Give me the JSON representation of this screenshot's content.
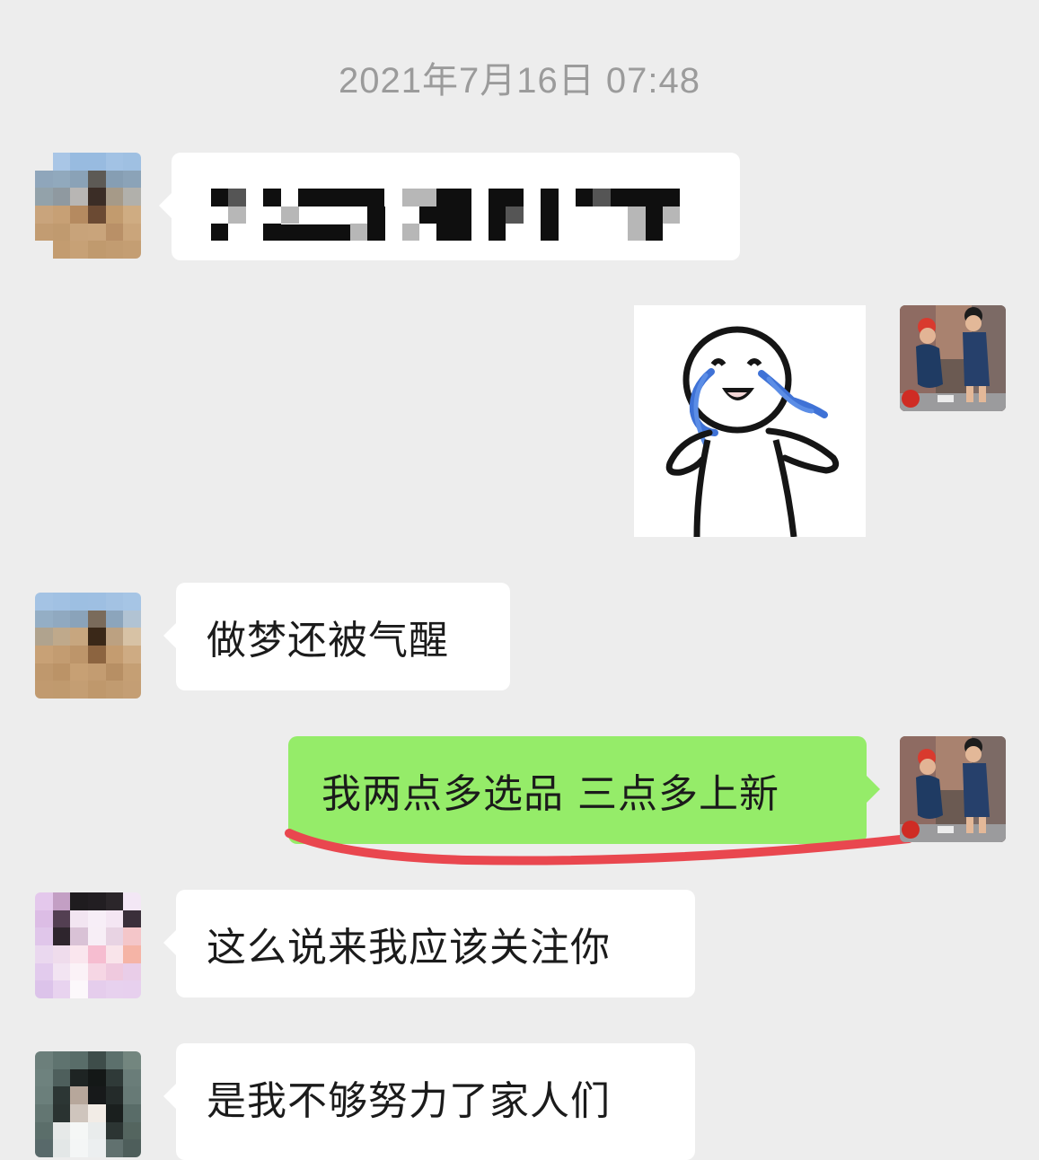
{
  "chat": {
    "timestamp": "2021年7月16日 07:48",
    "messages": [
      {
        "sender": "other",
        "type": "text",
        "text": "",
        "redacted": true
      },
      {
        "sender": "me",
        "type": "sticker",
        "sticker": "crying-stickman"
      },
      {
        "sender": "other",
        "type": "text",
        "text": "做梦还被气醒"
      },
      {
        "sender": "me",
        "type": "text",
        "text": "我两点多选品 三点多上新",
        "highlight_color": "#e9474f"
      },
      {
        "sender": "other",
        "type": "text",
        "text": "这么说来我应该关注你"
      },
      {
        "sender": "other",
        "type": "text",
        "text": "是我不够努力了家人们"
      }
    ]
  },
  "colors": {
    "background": "#ededed",
    "incoming_bubble": "#ffffff",
    "outgoing_bubble": "#95ec69",
    "timestamp_text": "#9b9b9b",
    "annotation_underline": "#e9474f"
  },
  "icons": {
    "avatar_other_1": "pixelated-avatar",
    "avatar_other_2": "pixelated-avatar",
    "avatar_other_3": "pixelated-avatar",
    "avatar_me": "photo-avatar-two-people"
  }
}
